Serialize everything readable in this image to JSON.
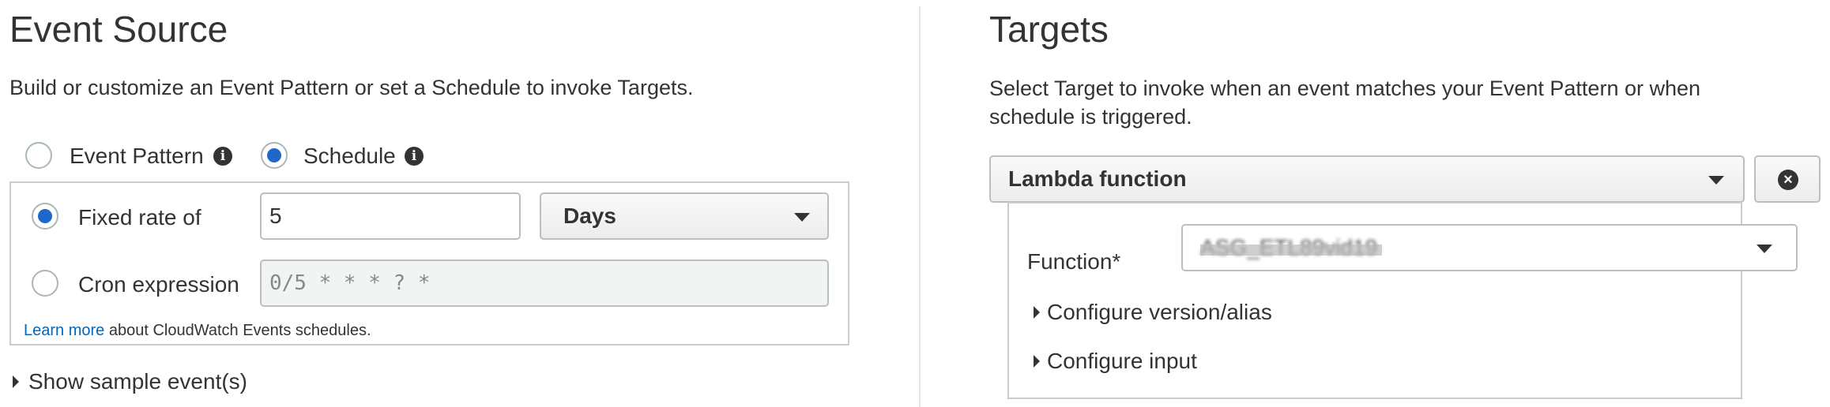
{
  "event_source": {
    "title": "Event Source",
    "description": "Build or customize an Event Pattern or set a Schedule to invoke Targets.",
    "mode_options": [
      {
        "label": "Event Pattern",
        "selected": false
      },
      {
        "label": "Schedule",
        "selected": true
      }
    ],
    "fixed_rate": {
      "label": "Fixed rate of",
      "selected": true,
      "value": "5",
      "unit": "Days"
    },
    "cron": {
      "label": "Cron expression",
      "selected": false,
      "placeholder": "0/5 * * * ? *"
    },
    "learn_more": {
      "link_text": "Learn more",
      "rest": " about CloudWatch Events schedules."
    },
    "show_sample": "Show sample event(s)"
  },
  "targets": {
    "title": "Targets",
    "description_line1": "Select Target to invoke when an event matches your Event Pattern or when",
    "description_line2": "schedule is triggered.",
    "target_type": "Lambda function",
    "function_label": "Function*",
    "function_value": "ASG_ETL89vid19",
    "configure_version": "Configure version/alias",
    "configure_input": "Configure input"
  },
  "colors": {
    "accent": "#1f68c9",
    "link": "#0066c0",
    "border": "#c8cdd0"
  }
}
